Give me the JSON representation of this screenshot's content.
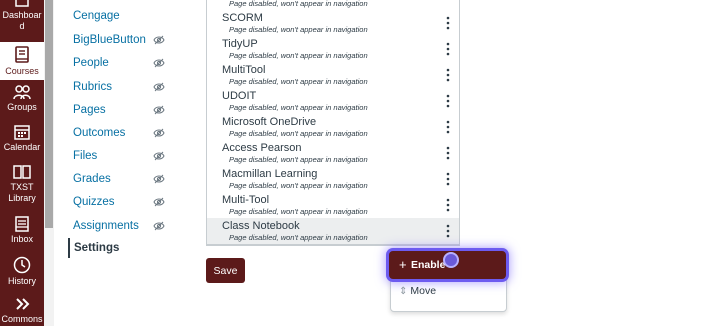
{
  "global_nav": {
    "items": [
      {
        "label": "Dashboar d",
        "icon": "dashboard-icon"
      },
      {
        "label": "Courses",
        "icon": "book-icon"
      },
      {
        "label": "Groups",
        "icon": "people-icon"
      },
      {
        "label": "Calendar",
        "icon": "calendar-icon"
      },
      {
        "label": "TXST Library",
        "icon": "library-icon"
      },
      {
        "label": "Inbox",
        "icon": "inbox-icon"
      },
      {
        "label": "History",
        "icon": "clock-icon"
      },
      {
        "label": "Commons",
        "icon": "commons-icon"
      }
    ]
  },
  "course_nav": {
    "items": [
      {
        "label": "Cengage"
      },
      {
        "label": "BigBlueButton"
      },
      {
        "label": "People"
      },
      {
        "label": "Rubrics"
      },
      {
        "label": "Pages"
      },
      {
        "label": "Outcomes"
      },
      {
        "label": "Files"
      },
      {
        "label": "Grades"
      },
      {
        "label": "Quizzes"
      },
      {
        "label": "Assignments"
      },
      {
        "label": "Settings"
      }
    ]
  },
  "hidden_items": {
    "subtitle": "Page disabled, won't appear in navigation",
    "rows": [
      {
        "title": ""
      },
      {
        "title": "SCORM"
      },
      {
        "title": "TidyUP"
      },
      {
        "title": "MultiTool"
      },
      {
        "title": "UDOIT"
      },
      {
        "title": "Microsoft OneDrive"
      },
      {
        "title": "Access Pearson"
      },
      {
        "title": "Macmillan Learning"
      },
      {
        "title": "Multi-Tool"
      },
      {
        "title": "Class Notebook"
      }
    ]
  },
  "buttons": {
    "save": "Save"
  },
  "menu": {
    "enable": "Enable",
    "move": "Move"
  },
  "colors": {
    "brand": "#5c1a1a",
    "link": "#0770a3",
    "focus": "#6d5bf0"
  }
}
